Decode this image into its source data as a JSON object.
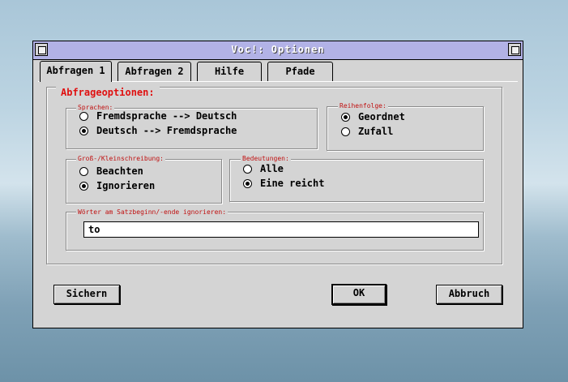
{
  "window": {
    "title": "Voc!: Optionen"
  },
  "tabs": [
    {
      "label": "Abfragen 1",
      "active": true
    },
    {
      "label": "Abfragen 2"
    },
    {
      "label": "Hilfe"
    },
    {
      "label": "Pfade"
    }
  ],
  "panel": {
    "title": "Abfrageoptionen:"
  },
  "sprachen": {
    "title": "Sprachen:",
    "options": [
      {
        "label": "Fremdsprache --> Deutsch",
        "selected": false
      },
      {
        "label": "Deutsch --> Fremdsprache",
        "selected": true
      }
    ]
  },
  "reihenfolge": {
    "title": "Reihenfolge:",
    "options": [
      {
        "label": "Geordnet",
        "selected": true
      },
      {
        "label": "Zufall",
        "selected": false
      }
    ]
  },
  "schreibung": {
    "title": "Groß-/Kleinschreibung:",
    "options": [
      {
        "label": "Beachten",
        "selected": false
      },
      {
        "label": "Ignorieren",
        "selected": true
      }
    ]
  },
  "bedeutungen": {
    "title": "Bedeutungen:",
    "options": [
      {
        "label": "Alle",
        "selected": false
      },
      {
        "label": "Eine reicht",
        "selected": true
      }
    ]
  },
  "ignore_words": {
    "title": "Wörter am Satzbeginn/-ende ignorieren:",
    "value": "to"
  },
  "buttons": {
    "save": "Sichern",
    "ok": "OK",
    "cancel": "Abbruch"
  },
  "colors": {
    "accent": "#e01010",
    "titlebar": "#b2b2e6"
  }
}
